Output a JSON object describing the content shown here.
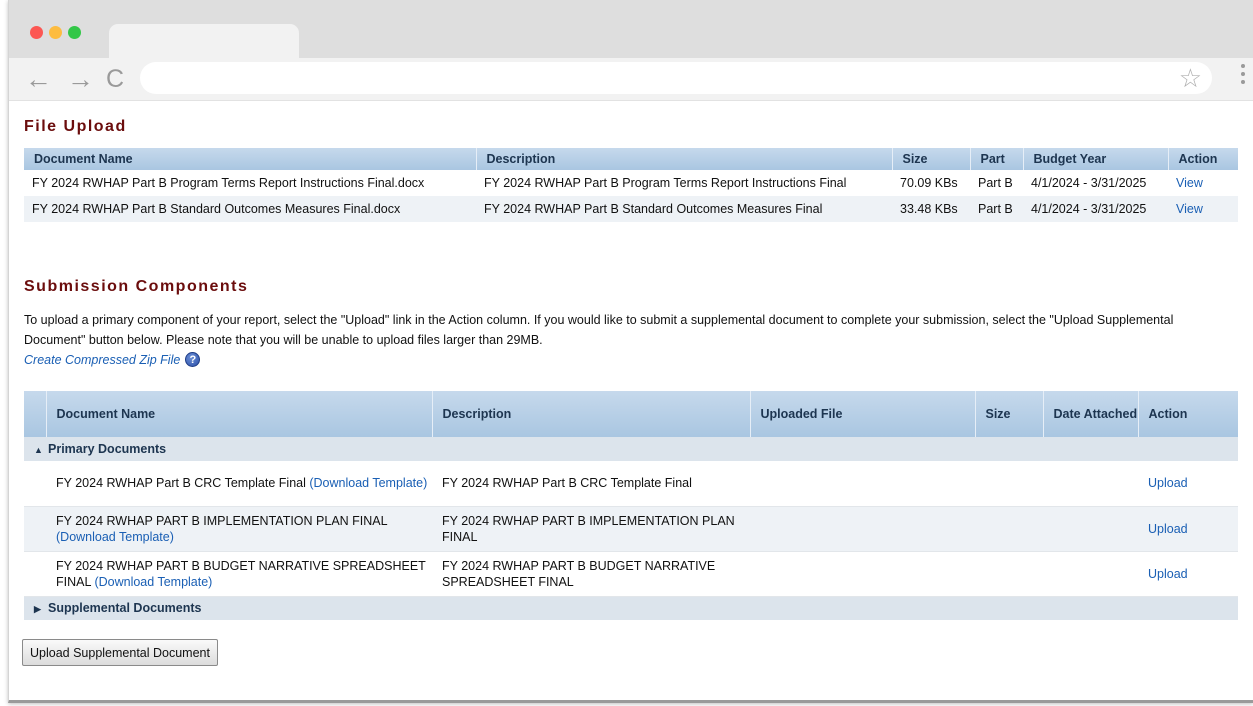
{
  "colors": {
    "title": "#6b0d0d",
    "link": "#1a5fb4",
    "header": "#b7d0e8"
  },
  "browser": {
    "back": "←",
    "forward": "→",
    "reload": "C",
    "star": "☆"
  },
  "file_upload": {
    "title": "File Upload",
    "headers": [
      "Document Name",
      "Description",
      "Size",
      "Part",
      "Budget Year",
      "Action"
    ],
    "rows": [
      {
        "name": "FY 2024 RWHAP Part B Program Terms Report Instructions Final.docx",
        "description": "FY 2024 RWHAP Part B Program Terms Report Instructions Final",
        "size": "70.09 KBs",
        "part": "Part B",
        "budget_year": "4/1/2024 - 3/31/2025",
        "action": "View"
      },
      {
        "name": "FY 2024 RWHAP Part B Standard Outcomes Measures Final.docx",
        "description": "FY 2024 RWHAP Part B Standard Outcomes Measures Final",
        "size": "33.48 KBs",
        "part": "Part B",
        "budget_year": "4/1/2024 - 3/31/2025",
        "action": "View"
      }
    ]
  },
  "submission": {
    "title": "Submission Components",
    "intro": "To upload a primary component of your report, select the \"Upload\" link in the Action column. If you would like to submit a supplemental document to complete your submission, select the \"Upload Supplemental Document\" button below. Please note that you will be unable to upload files larger than 29MB.",
    "zip_link": "Create Compressed Zip File",
    "help": "?",
    "headers": [
      "Document Name",
      "Description",
      "Uploaded File",
      "Size",
      "Date Attached",
      "Action"
    ],
    "primary_group": "Primary Documents",
    "supplemental_group": "Supplemental Documents",
    "rows": [
      {
        "name": "FY 2024 RWHAP Part B CRC Template Final",
        "template_link": "(Download Template)",
        "description": "FY 2024 RWHAP Part B CRC Template Final",
        "action": "Upload"
      },
      {
        "name": "FY 2024 RWHAP PART B IMPLEMENTATION PLAN FINAL",
        "template_link": "(Download Template)",
        "description": "FY 2024 RWHAP PART B IMPLEMENTATION PLAN FINAL",
        "action": "Upload"
      },
      {
        "name": "FY 2024 RWHAP PART B BUDGET NARRATIVE SPREADSHEET FINAL",
        "template_link": "(Download Template)",
        "description": "FY 2024 RWHAP PART B BUDGET NARRATIVE SPREADSHEET FINAL",
        "action": "Upload"
      }
    ],
    "upload_button": "Upload Supplemental Document"
  }
}
